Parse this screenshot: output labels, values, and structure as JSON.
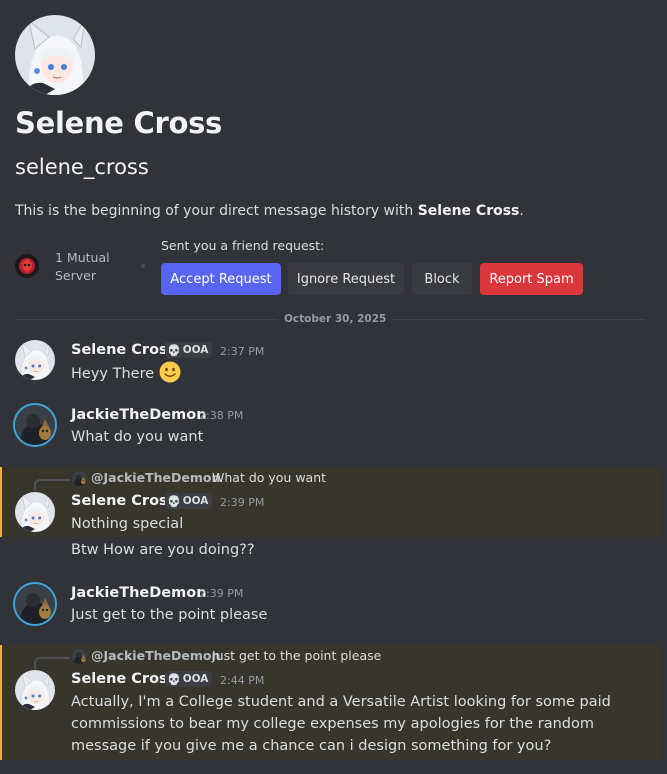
{
  "profile": {
    "display_name": "Selene Cross",
    "username": "selene_cross",
    "intro_prefix": "This is the beginning of your direct message history with ",
    "intro_name": "Selene Cross",
    "intro_suffix": ".",
    "mutual_servers": "1 Mutual Server",
    "friend_request_label": "Sent you a friend request:"
  },
  "actions": {
    "accept": "Accept Request",
    "ignore": "Ignore Request",
    "block": "Block",
    "report": "Report Spam"
  },
  "date_divider": "October 30, 2025",
  "colors": {
    "background": "#313338",
    "accent": "#5865f2",
    "danger": "#da373c",
    "mention_highlight": "#38352c",
    "mention_bar": "#f0b232"
  },
  "messages": [
    {
      "author": "Selene Cross",
      "tag": "OOA",
      "tag_icon": "skull-icon",
      "time": "2:37 PM",
      "text": "Heyy There",
      "emoji": "slightly-smiling-face-icon"
    },
    {
      "author": "JackieTheDemon",
      "time": "2:38 PM",
      "text": "What do you want"
    },
    {
      "reply_to": "@JackieTheDemon",
      "reply_text": "What do you want",
      "author": "Selene Cross",
      "tag": "OOA",
      "tag_icon": "skull-icon",
      "time": "2:39 PM",
      "text": "Nothing special",
      "followup": "Btw How are you doing??"
    },
    {
      "author": "JackieTheDemon",
      "time": "2:39 PM",
      "text": "Just get to the point please"
    },
    {
      "reply_to": "@JackieTheDemon",
      "reply_text": "Just get to the point please",
      "author": "Selene Cross",
      "tag": "OOA",
      "tag_icon": "skull-icon",
      "time": "2:44 PM",
      "text": "Actually, I'm a College student and a Versatile Artist looking for some paid commissions to bear my college expenses my apologies for the random message if you give me a chance can i design something for you?"
    }
  ]
}
